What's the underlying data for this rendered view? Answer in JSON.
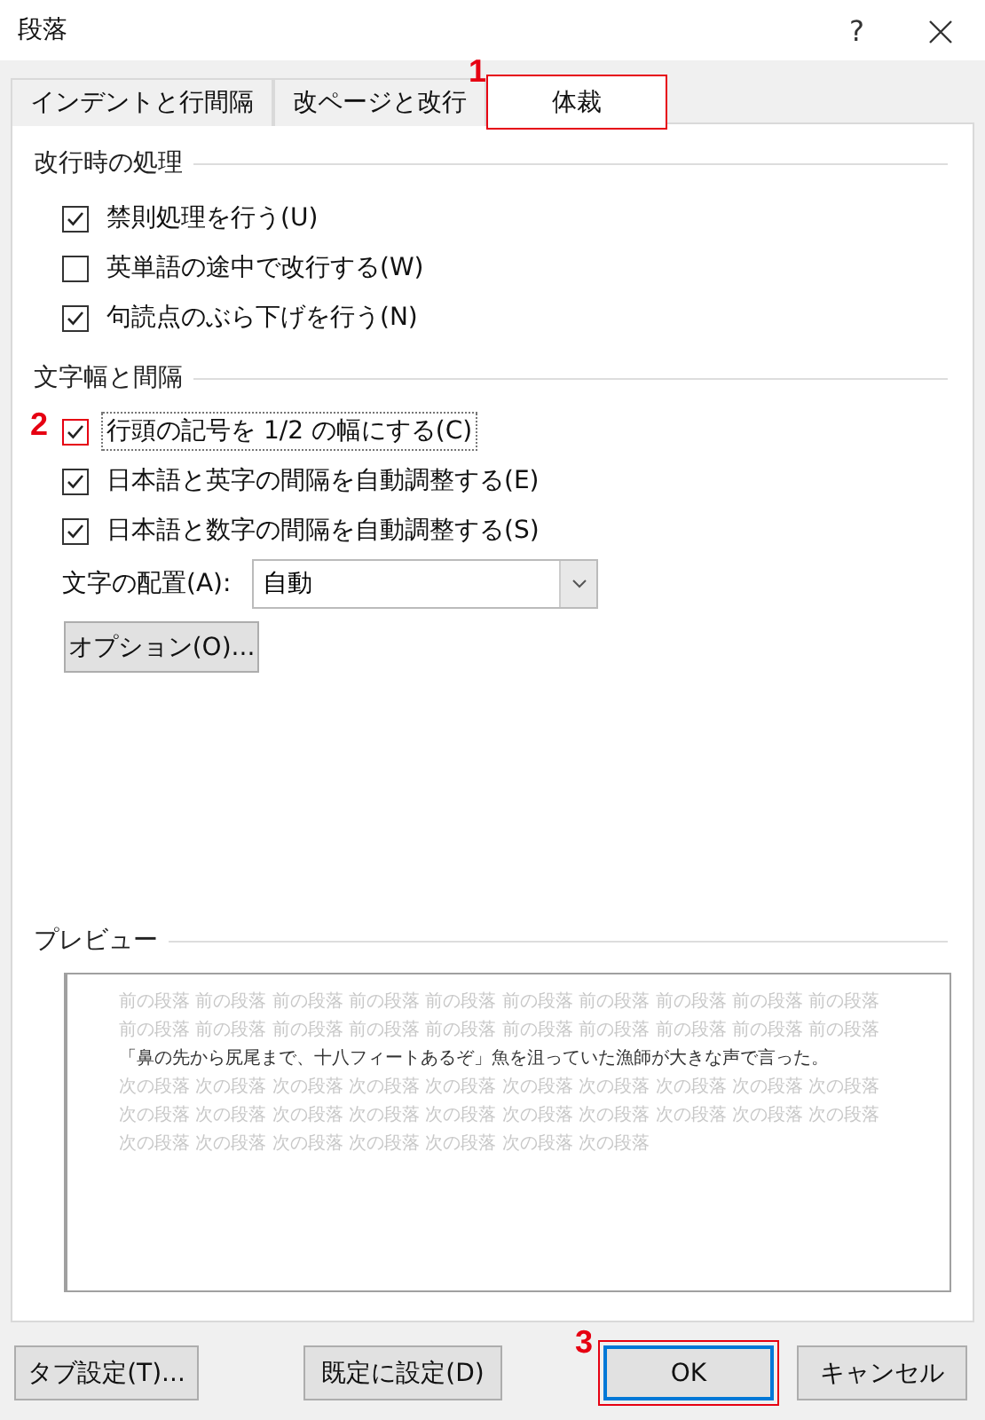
{
  "window": {
    "title": "段落",
    "help": "?"
  },
  "tabs": [
    {
      "label": "インデントと行間隔",
      "selected": false
    },
    {
      "label": "改ページと改行",
      "selected": false
    },
    {
      "label": "体裁",
      "selected": true,
      "callout": "1"
    }
  ],
  "sections": [
    {
      "title": "改行時の処理",
      "options": [
        {
          "label": "禁則処理を行う(U)",
          "checked": true,
          "focused": false
        },
        {
          "label": "英単語の途中で改行する(W)",
          "checked": false,
          "focused": false
        },
        {
          "label": "句読点のぶら下げを行う(N)",
          "checked": true,
          "focused": false
        }
      ]
    },
    {
      "title": "文字幅と間隔",
      "options": [
        {
          "label": "行頭の記号を 1/2 の幅にする(C)",
          "checked": true,
          "focused": true,
          "callout": "2"
        },
        {
          "label": "日本語と英字の間隔を自動調整する(E)",
          "checked": true,
          "focused": false
        },
        {
          "label": "日本語と数字の間隔を自動調整する(S)",
          "checked": true,
          "focused": false
        }
      ]
    }
  ],
  "alignment": {
    "label": "文字の配置(A):",
    "value": "自動"
  },
  "options_button": "オプション(O)...",
  "preview": {
    "title": "プレビュー",
    "lines": [
      {
        "text": "前の段落 前の段落 前の段落 前の段落 前の段落 前の段落 前の段落 前の段落 前の段落 前の段落",
        "kind": "context"
      },
      {
        "text": "前の段落 前の段落 前の段落 前の段落 前の段落 前の段落 前の段落 前の段落 前の段落 前の段落",
        "kind": "context"
      },
      {
        "text": "「鼻の先から尻尾まで、十八フィートあるぞ」魚を沮っていた漁師が大きな声で言った。",
        "kind": "sample"
      },
      {
        "text": "次の段落 次の段落 次の段落 次の段落 次の段落 次の段落 次の段落 次の段落 次の段落 次の段落",
        "kind": "context"
      },
      {
        "text": "次の段落 次の段落 次の段落 次の段落 次の段落 次の段落 次の段落 次の段落 次の段落 次の段落",
        "kind": "context"
      },
      {
        "text": "次の段落 次の段落 次の段落 次の段落 次の段落 次の段落 次の段落",
        "kind": "context"
      }
    ]
  },
  "buttons": [
    {
      "label": "タブ設定(T)...",
      "kind": "left"
    },
    {
      "label": "既定に設定(D)",
      "kind": "middle"
    },
    {
      "label": "OK",
      "kind": "default",
      "callout": "3"
    },
    {
      "label": "キャンセル",
      "kind": "right"
    }
  ]
}
